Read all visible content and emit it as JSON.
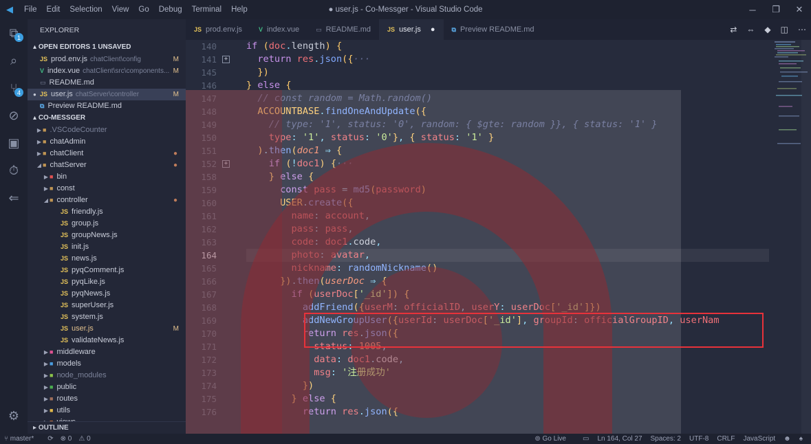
{
  "window": {
    "title": "● user.js - Co-Messger - Visual Studio Code",
    "menu": [
      "File",
      "Edit",
      "Selection",
      "View",
      "Go",
      "Debug",
      "Terminal",
      "Help"
    ],
    "controls": [
      "─",
      "❐",
      "✕"
    ]
  },
  "activity": {
    "explorer_badge": "1",
    "scm_badge": "4"
  },
  "sidebar": {
    "title": "EXPLORER",
    "open_editors": "OPEN EDITORS  1 UNSAVED",
    "open": [
      {
        "icon": "JS",
        "name": "prod.env.js",
        "desc": "chatClient\\config",
        "flag": "M"
      },
      {
        "icon": "V",
        "name": "index.vue",
        "desc": "chatClient\\src\\components...",
        "flag": "M"
      },
      {
        "icon": "▭",
        "name": "README.md",
        "desc": "",
        "flag": ""
      },
      {
        "icon": "JS",
        "name": "user.js",
        "desc": "chatServer\\controller",
        "flag": "M"
      },
      {
        "icon": "⧉",
        "name": "Preview README.md",
        "desc": "",
        "flag": ""
      }
    ],
    "project": "CO-MESSGER",
    "tree": [
      {
        "name": ".VSCodeCounter"
      },
      {
        "name": "chatAdmin"
      },
      {
        "name": "chatClient"
      },
      {
        "name": "chatServer"
      },
      {
        "name": "bin"
      },
      {
        "name": "const"
      },
      {
        "name": "controller"
      },
      {
        "name": "friendly.js"
      },
      {
        "name": "group.js"
      },
      {
        "name": "groupNews.js"
      },
      {
        "name": "init.js"
      },
      {
        "name": "news.js"
      },
      {
        "name": "pyqComment.js"
      },
      {
        "name": "pyqLike.js"
      },
      {
        "name": "pyqNews.js"
      },
      {
        "name": "superUser.js"
      },
      {
        "name": "system.js"
      },
      {
        "name": "user.js",
        "flag": "M"
      },
      {
        "name": "validateNews.js"
      },
      {
        "name": "middleware"
      },
      {
        "name": "models"
      },
      {
        "name": "node_modules"
      },
      {
        "name": "public"
      },
      {
        "name": "routes"
      },
      {
        "name": "utils"
      },
      {
        "name": "views"
      }
    ],
    "outline": "OUTLINE"
  },
  "tabs": [
    {
      "icon": "JS",
      "label": "prod.env.js"
    },
    {
      "icon": "V",
      "label": "index.vue"
    },
    {
      "icon": "▭",
      "label": "README.md"
    },
    {
      "icon": "JS",
      "label": "user.js"
    },
    {
      "icon": "⧉",
      "label": "Preview README.md"
    }
  ],
  "editor": {
    "line_numbers": [
      "140",
      "141",
      "145",
      "146",
      "147",
      "148",
      "149",
      "150",
      "151",
      "152",
      "158",
      "159",
      "160",
      "161",
      "162",
      "163",
      "164",
      "165",
      "166",
      "167",
      "168",
      "169",
      "170",
      "171",
      "172",
      "173",
      "174",
      "175",
      "176"
    ],
    "current_line": "164"
  },
  "status": {
    "branch": "master*",
    "sync": "⟳",
    "errors": "⊗ 0",
    "warnings": "⚠ 0",
    "golive": "Go Live",
    "position": "Ln 164, Col 27",
    "spaces": "Spaces: 2",
    "encoding": "UTF-8",
    "eol": "CRLF",
    "language": "JavaScript"
  },
  "colors": {
    "background": "#262b3c",
    "highlight_box": "#e8323a",
    "watermark": "#8e2b33"
  }
}
